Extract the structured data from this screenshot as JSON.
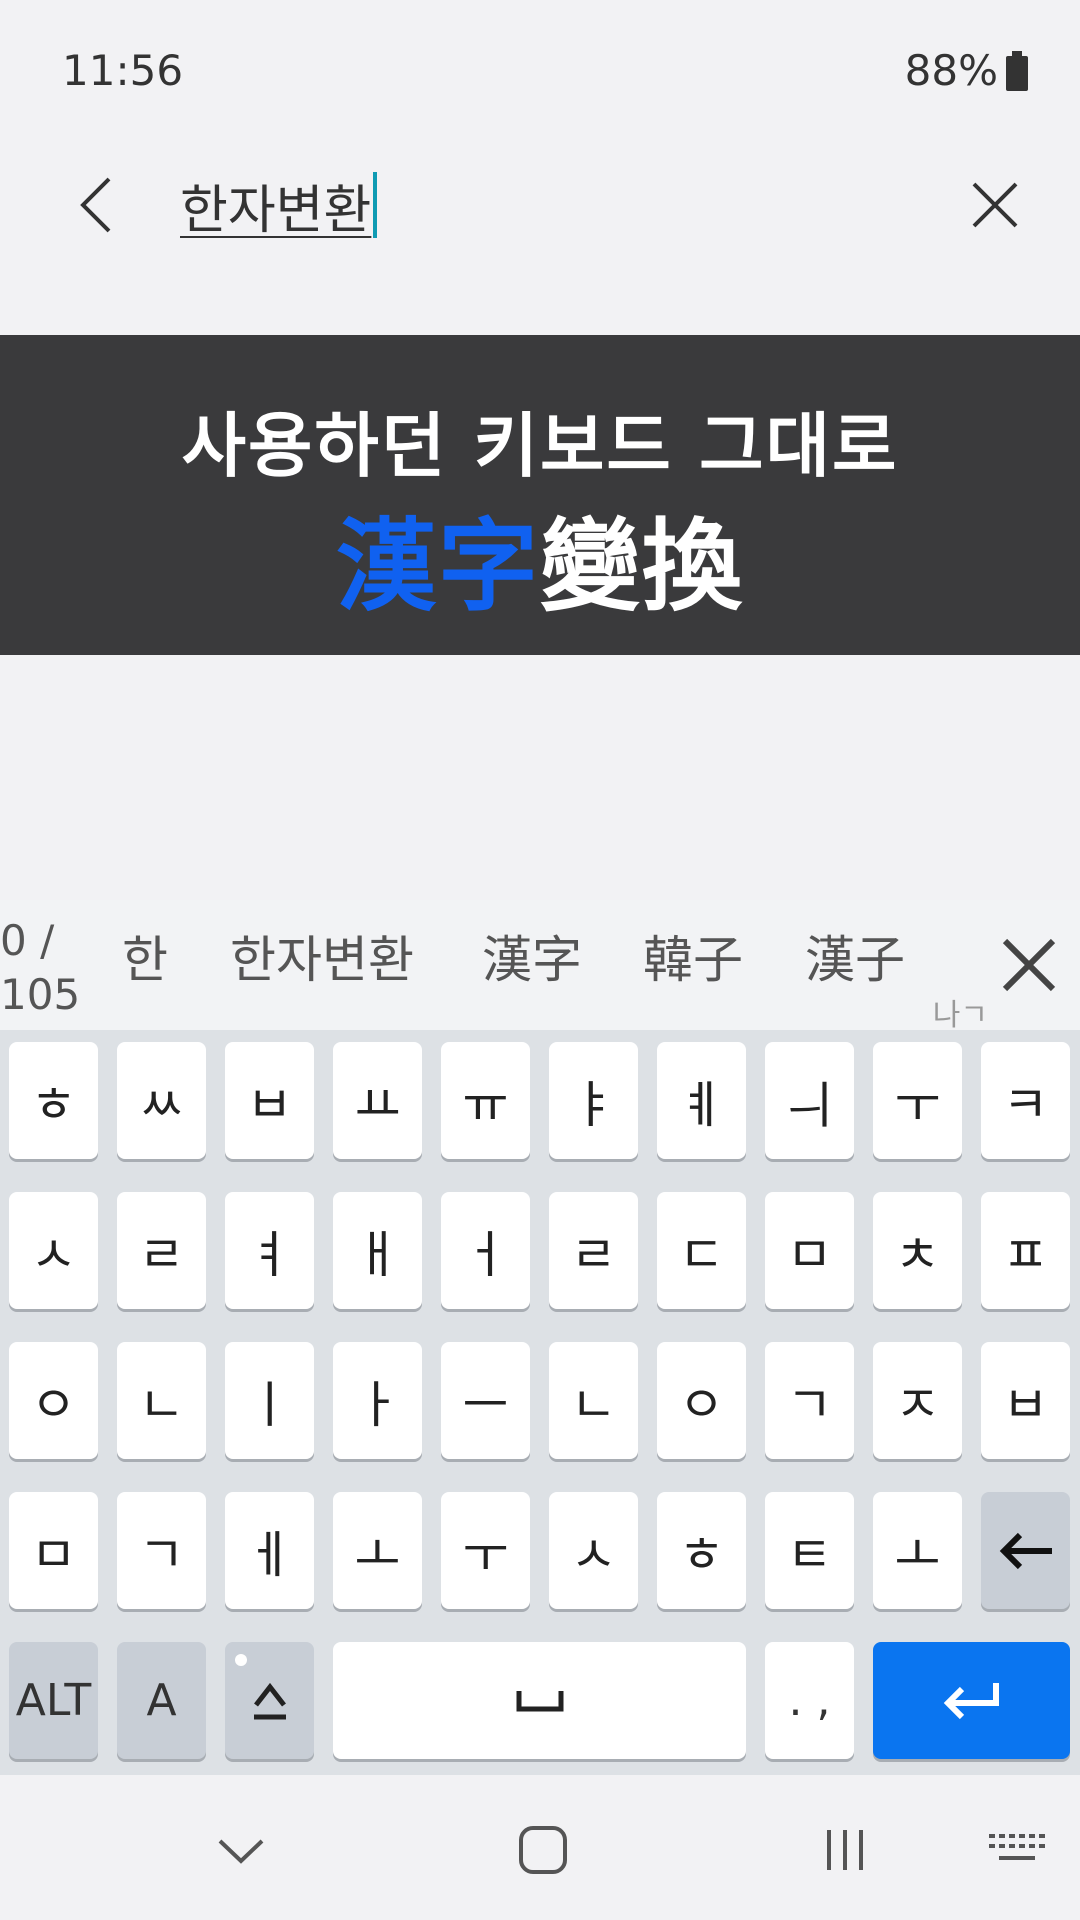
{
  "status_bar": {
    "time": "11:56",
    "battery": "88%"
  },
  "search": {
    "query": "한자변환"
  },
  "banner": {
    "line1": "사용하던 키보드 그대로",
    "line2_blue": "漢字",
    "line2_white": "變換"
  },
  "suggestions": {
    "count_top": "0 /",
    "count_bottom": "105",
    "items": [
      "한",
      "한자변환",
      "漢字",
      "韓子",
      "漢子"
    ],
    "hint": "나ㄱ"
  },
  "keyboard": {
    "row1": [
      "ㅎ",
      "ㅆ",
      "ㅂ",
      "ㅛ",
      "ㅠ",
      "ㅑ",
      "ㅖ",
      "ㅢ",
      "ㅜ",
      "ㅋ"
    ],
    "row2": [
      "ㅅ",
      "ㄹ",
      "ㅕ",
      "ㅐ",
      "ㅓ",
      "ㄹ",
      "ㄷ",
      "ㅁ",
      "ㅊ",
      "ㅍ"
    ],
    "row3": [
      "ㅇ",
      "ㄴ",
      "ㅣ",
      "ㅏ",
      "ㅡ",
      "ㄴ",
      "ㅇ",
      "ㄱ",
      "ㅈ",
      "ㅂ"
    ],
    "row4": [
      "ㅁ",
      "ㄱ",
      "ㅔ",
      "ㅗ",
      "ㅜ",
      "ㅅ",
      "ㅎ",
      "ㅌ",
      "ㅗ"
    ],
    "backspace": "←",
    "alt": "ALT",
    "lang": "A",
    "shift": "⇧",
    "space": "␣",
    "punct": ". ,",
    "enter": "↵"
  },
  "icons": {
    "back": "chevron-left-icon",
    "clear": "close-icon",
    "nav_back": "chevron-down-icon",
    "nav_home": "home-icon",
    "nav_recents": "recents-icon",
    "nav_keyboard": "keyboard-icon"
  },
  "colors": {
    "accent_blue": "#0a75f0",
    "banner_bg": "#3a3a3c",
    "banner_blue": "#1061f0"
  }
}
